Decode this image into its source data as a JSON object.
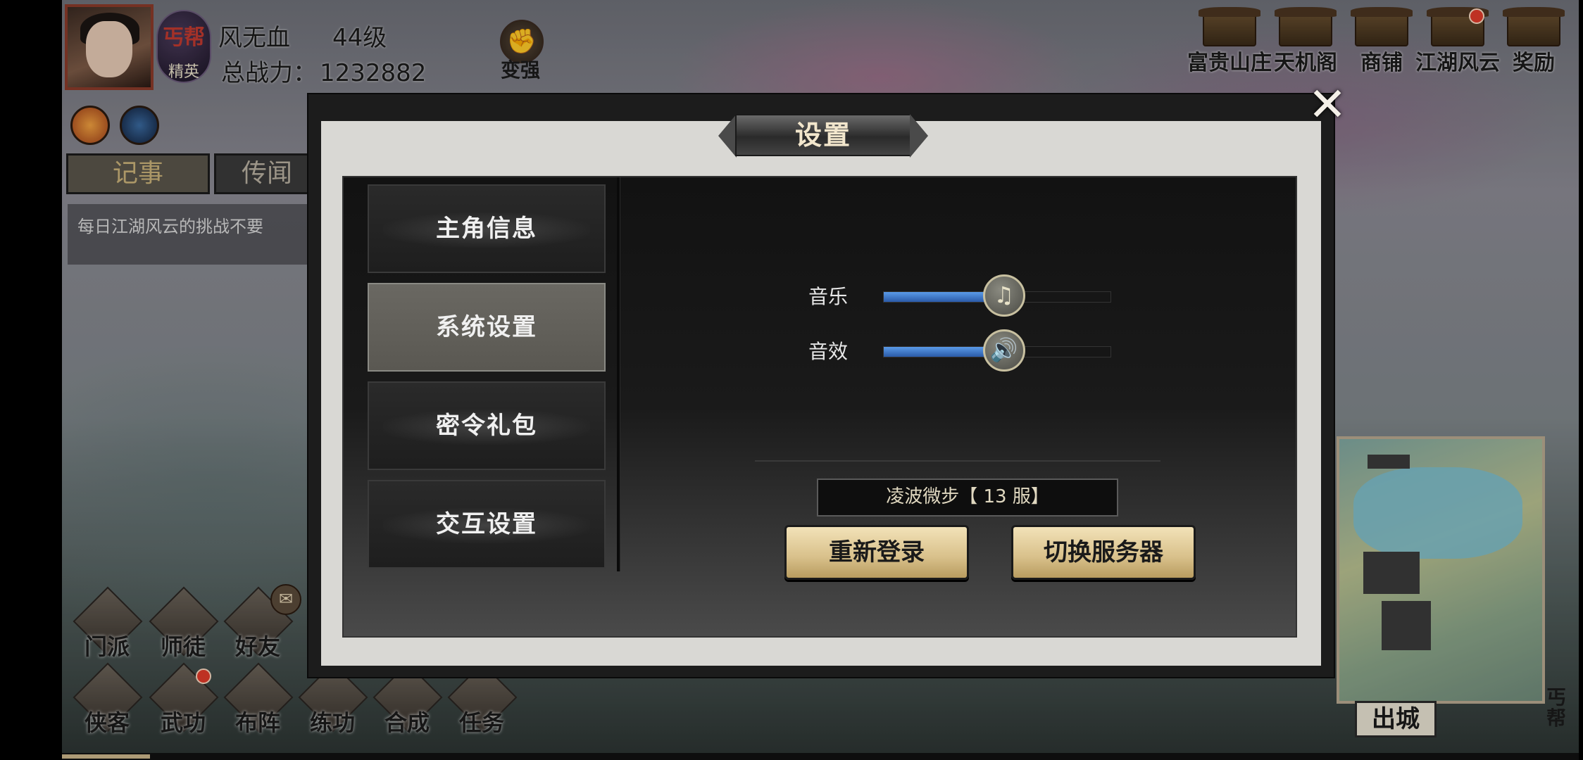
{
  "player": {
    "name": "风无血",
    "level": "44级",
    "guild_short": "丐帮",
    "rank": "精英",
    "power_label": "总战力：",
    "power_value": "1232882",
    "strengthen_label": "变强"
  },
  "tabs": [
    {
      "label": "记事",
      "active": true
    },
    {
      "label": "传闻",
      "active": false
    }
  ],
  "ticker": {
    "text": "每日江湖风云的挑战不要"
  },
  "top_menu": [
    {
      "label": "富贵山庄",
      "icon": "manor-icon",
      "badge": false
    },
    {
      "label": "天机阁",
      "icon": "pavilion-icon",
      "badge": false
    },
    {
      "label": "商铺",
      "icon": "shop-icon",
      "badge": false
    },
    {
      "label": "江湖风云",
      "icon": "horn-icon",
      "badge": true
    },
    {
      "label": "奖励",
      "icon": "reward-icon",
      "badge": false
    }
  ],
  "bottom_menu_row1": [
    {
      "label": "门派",
      "icon": "sect-icon"
    },
    {
      "label": "师徒",
      "icon": "mentor-icon"
    },
    {
      "label": "好友",
      "icon": "friends-icon"
    }
  ],
  "bottom_menu_row2": [
    {
      "label": "侠客",
      "icon": "hero-icon",
      "badge": false
    },
    {
      "label": "武功",
      "icon": "martial-arts-icon",
      "badge": true
    },
    {
      "label": "布阵",
      "icon": "formation-icon",
      "badge": false
    },
    {
      "label": "练功",
      "icon": "training-icon",
      "badge": false
    },
    {
      "label": "合成",
      "icon": "crafting-icon",
      "badge": false
    },
    {
      "label": "任务",
      "icon": "quest-icon",
      "badge": false
    }
  ],
  "minimap": {
    "leave_label": "出城",
    "guild_label": "丐帮"
  },
  "settings": {
    "title": "设置",
    "close_icon": "✕",
    "menu": [
      {
        "label": "主角信息",
        "active": false
      },
      {
        "label": "系统设置",
        "active": true
      },
      {
        "label": "密令礼包",
        "active": false
      },
      {
        "label": "交互设置",
        "active": false
      }
    ],
    "music": {
      "label": "音乐",
      "value": 0.53,
      "icon": "♫"
    },
    "sound": {
      "label": "音效",
      "value": 0.53,
      "icon": "🔊"
    },
    "server": "凌波微步【 13 服】",
    "relogin_label": "重新登录",
    "switch_server_label": "切换服务器"
  },
  "colors": {
    "accent_blue": "#3a7ad0",
    "gold_button": "#d8c08a",
    "badge_red": "#e03a2a"
  }
}
